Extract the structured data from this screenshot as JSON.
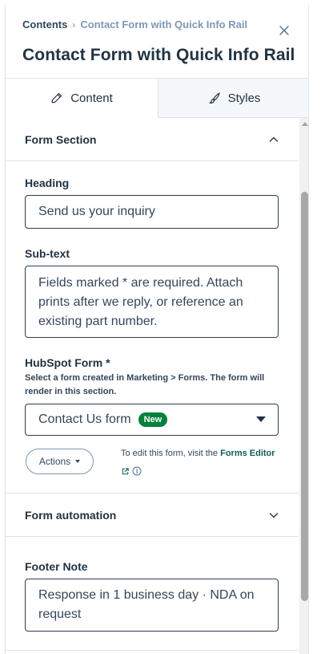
{
  "header": {
    "breadcrumb_root": "Contents",
    "breadcrumb_separator": "›",
    "breadcrumb_current": "Contact Form with Quick Info Rail",
    "title": "Contact Form with Quick Info Rail"
  },
  "tabs": [
    {
      "label": "Content",
      "icon": "pencil-icon",
      "active": true
    },
    {
      "label": "Styles",
      "icon": "brush-icon",
      "active": false
    }
  ],
  "form_section": {
    "title": "Form Section",
    "heading_label": "Heading",
    "heading_value": "Send us your inquiry",
    "subtext_label": "Sub-text",
    "subtext_value": "Fields marked * are required. Attach prints after we reply, or reference an existing part number.",
    "hubspot_form_label": "HubSpot Form *",
    "hubspot_form_help": "Select a form created in Marketing > Forms. The form will render in this section.",
    "selected_form": "Contact Us form",
    "selected_form_badge": "New",
    "actions_label": "Actions",
    "edit_note_prefix": "To edit this form, visit the",
    "edit_link": "Forms Editor"
  },
  "form_automation": {
    "title": "Form automation"
  },
  "footer_note": {
    "label": "Footer Note",
    "value": "Response in 1 business day · NDA on request"
  },
  "colors": {
    "accent_link": "#0b5d56",
    "badge_green": "#00823a",
    "text": "#213343",
    "border": "#dfe3eb"
  }
}
